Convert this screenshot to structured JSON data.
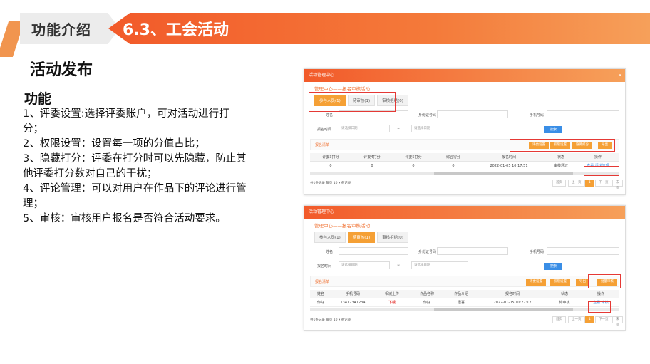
{
  "header": {
    "section": "功能介绍",
    "title": "6.3、工会活动"
  },
  "subtitle": "活动发布",
  "features": {
    "title": "功能",
    "items": [
      "1、评委设置:选择评委账户，可对活动进行打分；",
      "2、权限设置：设置每一项的分值占比；",
      "3、隐藏打分：评委在打分时可以先隐藏，防止其他评委打分数对自己的干扰；",
      "4、评论管理：可以对用户在作品下的评论进行管理；",
      "5、审核：审核用户报名是否符合活动要求。"
    ]
  },
  "panel1": {
    "window_title": "活动管理中心",
    "breadcrumb": "管理中心——报名审核活动",
    "tabs": [
      "参与人员(1)",
      "待审核(1)",
      "审核拒绝(0)"
    ],
    "fields": {
      "name": "姓名",
      "id": "身份证号码",
      "phone": "手机号码",
      "time": "报名时间",
      "start_ph": "请选择日期",
      "end_ph": "请选择日期",
      "dash": "~"
    },
    "search": "搜索",
    "list_label": "报名清单",
    "actions": [
      "评委设置",
      "权限设置",
      "隐藏打分",
      "导出"
    ],
    "columns": [
      "评委3打分",
      "评委4打分",
      "评委5打分",
      "综合得分",
      "报名时间",
      "状态",
      "操作"
    ],
    "row": [
      "0",
      "0",
      "0",
      "0",
      "2022-01-05 10:17:51",
      "审核通过",
      "查看 评论管理"
    ],
    "pager": {
      "total": "共1条记录  每页 10 ▾ 条记录",
      "first": "首页",
      "prev": "上一页",
      "page": "1",
      "next": "下一页",
      "last": "末页"
    }
  },
  "panel2": {
    "window_title": "活动管理中心",
    "breadcrumb": "管理中心——报名审核活动",
    "tabs": [
      "参与人员(1)",
      "待审核(1)",
      "审核拒绝(0)"
    ],
    "fields": {
      "name": "姓名",
      "id": "身份证号码",
      "phone": "手机号码",
      "time": "报名时间",
      "start_ph": "请选择日期",
      "end_ph": "请选择日期",
      "dash": "~"
    },
    "search": "搜索",
    "list_label": "报名清单",
    "actions": [
      "评委设置",
      "权限设置",
      "导出",
      "批量审核"
    ],
    "columns": [
      "姓名",
      "手机号码",
      "相减上传",
      "作品名称",
      "作品介绍",
      "报名时间",
      "状态",
      "操作"
    ],
    "row": [
      "你好",
      "13412341234",
      "下载",
      "你好",
      "很喜",
      "2022-01-05 10:22:12",
      "待审核",
      "查看 审核"
    ],
    "pager": {
      "total": "共1条记录  每页 10 ▾ 条记录",
      "first": "首页",
      "prev": "上一页",
      "page": "1",
      "next": "下一页",
      "last": "末页"
    }
  }
}
